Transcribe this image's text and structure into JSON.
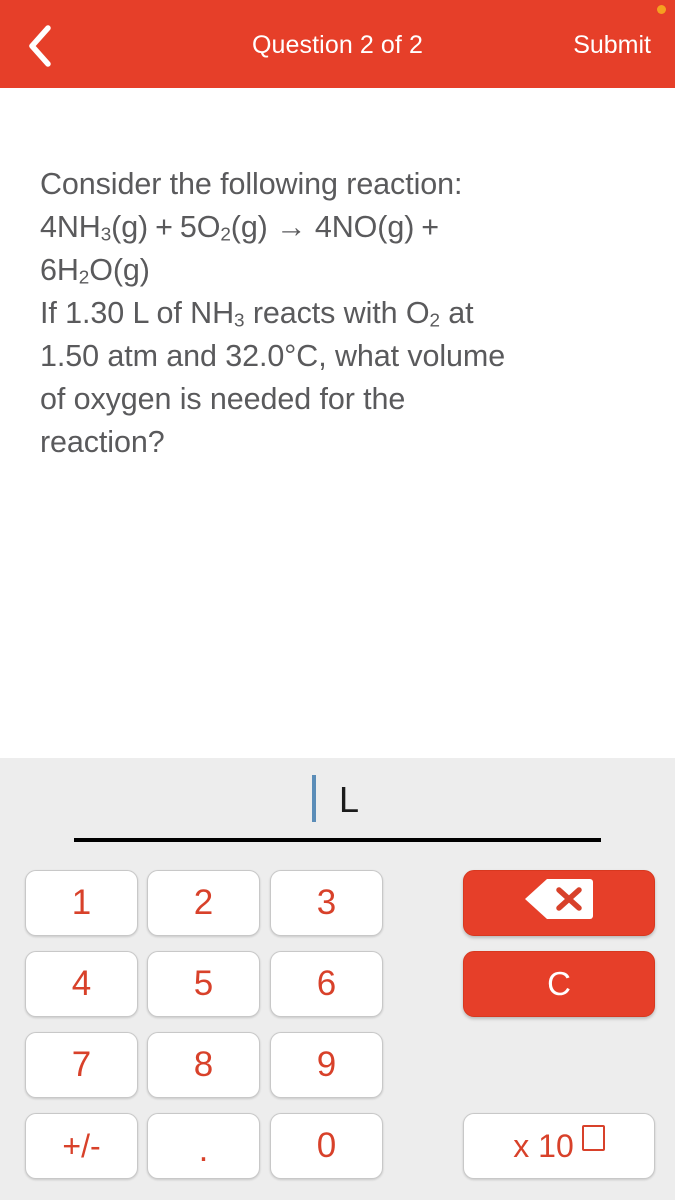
{
  "header": {
    "back_icon": "chevron-left-icon",
    "title": "Question 2 of 2",
    "submit_label": "Submit",
    "bg_color": "#e63f29",
    "text_color": "#ffffff",
    "corner_dot_color": "#f5a020"
  },
  "question": {
    "intro": "Consider the following reaction:",
    "equation": {
      "line1_parts": [
        "4NH",
        "3",
        "(g)  +  5O",
        "2",
        "(g) → 4NO(g)  +"
      ],
      "line1_plain": "4NH3(g) + 5O2(g) → 4NO(g) +",
      "line2_plain": "6H2O(g)"
    },
    "body_line1": "If 1.30 L of NH",
    "body_line1_sub": "3",
    "body_line1_cont": " reacts with O",
    "body_line1_sub2": "2",
    "body_line1_end": " at",
    "body_line2": "1.50 atm and 32.0°C, what volume",
    "body_line3": "of oxygen is needed for the",
    "body_line4": "reaction?",
    "text_color": "#5a5a5c"
  },
  "answer": {
    "value": "",
    "unit": "L",
    "caret_color": "#5b8db8",
    "underline_color": "#000000"
  },
  "keypad": {
    "bg_color": "#ededed",
    "key_text_color": "#d8412a",
    "action_bg_color": "#e63f29",
    "keys": [
      {
        "label": "1",
        "name": "key-1"
      },
      {
        "label": "2",
        "name": "key-2"
      },
      {
        "label": "3",
        "name": "key-3"
      },
      {
        "label": "4",
        "name": "key-4"
      },
      {
        "label": "5",
        "name": "key-5"
      },
      {
        "label": "6",
        "name": "key-6"
      },
      {
        "label": "7",
        "name": "key-7"
      },
      {
        "label": "8",
        "name": "key-8"
      },
      {
        "label": "9",
        "name": "key-9"
      },
      {
        "label": "+/-",
        "name": "key-plus-minus"
      },
      {
        "label": ".",
        "name": "key-decimal"
      },
      {
        "label": "0",
        "name": "key-0"
      }
    ],
    "backspace_icon": "backspace-delete-icon",
    "clear_label": "C",
    "exponent_label": "x 10"
  }
}
